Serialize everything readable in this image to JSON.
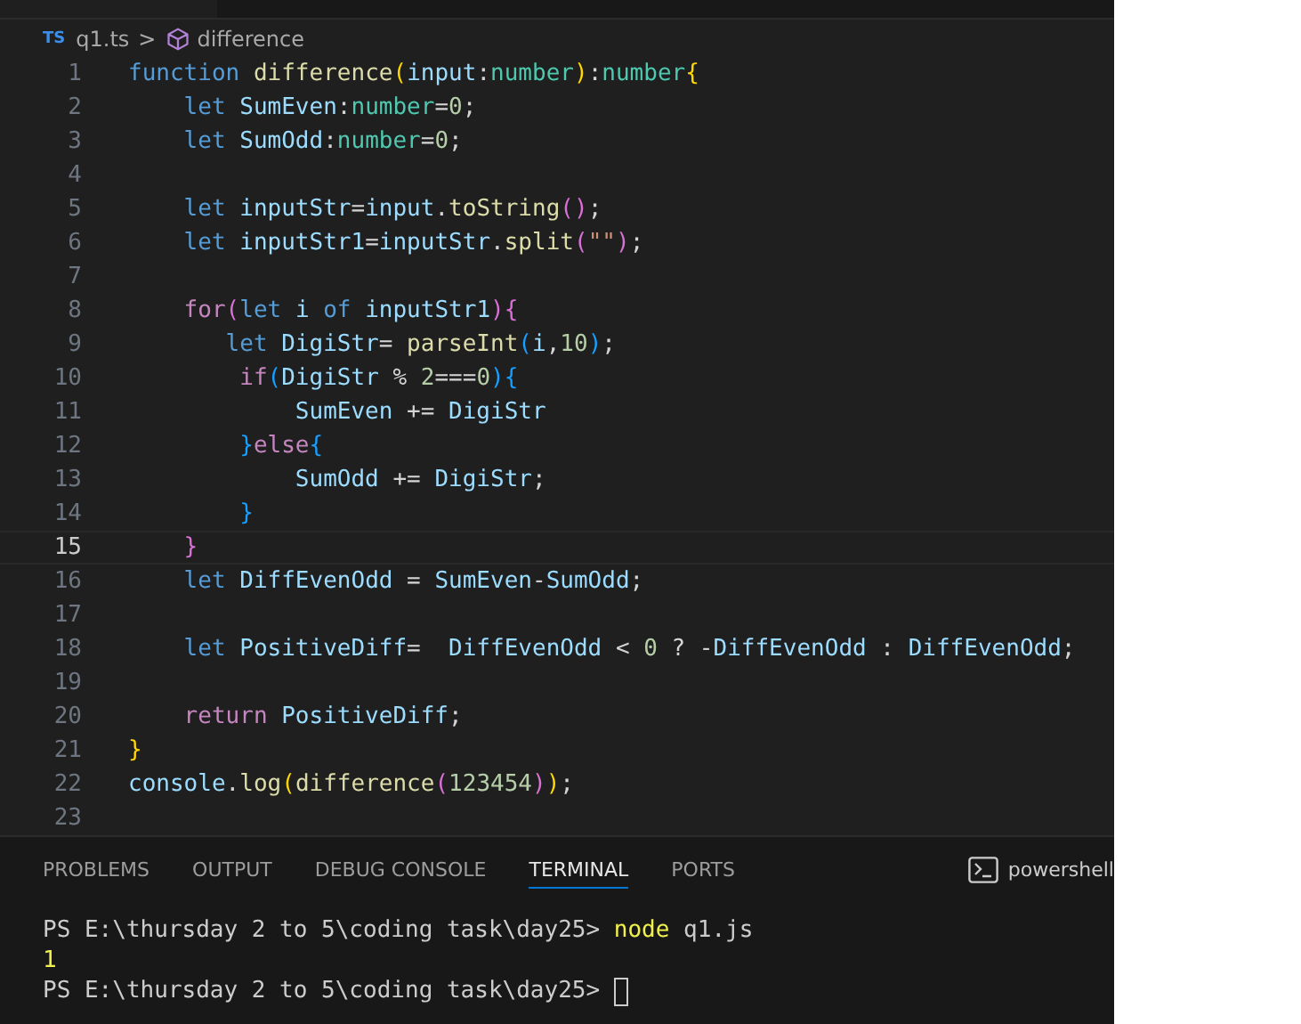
{
  "breadcrumb": {
    "file_badge": "TS",
    "file": "q1.ts",
    "separator": ">",
    "symbol": "difference"
  },
  "code_lines": [
    {
      "number": "1",
      "current": false,
      "tokens": [
        {
          "t": "function ",
          "color": "#569cd6"
        },
        {
          "t": "difference",
          "color": "#dcdcaa"
        },
        {
          "t": "(",
          "color": "#ffd700"
        },
        {
          "t": "input",
          "color": "#9cdcfe"
        },
        {
          "t": ":",
          "color": "#d4d4d4"
        },
        {
          "t": "number",
          "color": "#4ec9b0"
        },
        {
          "t": ")",
          "color": "#ffd700"
        },
        {
          "t": ":",
          "color": "#d4d4d4"
        },
        {
          "t": "number",
          "color": "#4ec9b0"
        },
        {
          "t": "{",
          "color": "#ffd700"
        }
      ]
    },
    {
      "number": "2",
      "current": false,
      "tokens": [
        {
          "t": "    let ",
          "color": "#569cd6"
        },
        {
          "t": "SumEven",
          "color": "#9cdcfe"
        },
        {
          "t": ":",
          "color": "#d4d4d4"
        },
        {
          "t": "number",
          "color": "#4ec9b0"
        },
        {
          "t": "=",
          "color": "#d4d4d4"
        },
        {
          "t": "0",
          "color": "#b5cea8"
        },
        {
          "t": ";",
          "color": "#d4d4d4"
        }
      ]
    },
    {
      "number": "3",
      "current": false,
      "tokens": [
        {
          "t": "    let ",
          "color": "#569cd6"
        },
        {
          "t": "SumOdd",
          "color": "#9cdcfe"
        },
        {
          "t": ":",
          "color": "#d4d4d4"
        },
        {
          "t": "number",
          "color": "#4ec9b0"
        },
        {
          "t": "=",
          "color": "#d4d4d4"
        },
        {
          "t": "0",
          "color": "#b5cea8"
        },
        {
          "t": ";",
          "color": "#d4d4d4"
        }
      ]
    },
    {
      "number": "4",
      "current": false
    },
    {
      "number": "5",
      "current": false,
      "tokens": [
        {
          "t": "    let ",
          "color": "#569cd6"
        },
        {
          "t": "inputStr",
          "color": "#9cdcfe"
        },
        {
          "t": "=",
          "color": "#d4d4d4"
        },
        {
          "t": "input",
          "color": "#9cdcfe"
        },
        {
          "t": ".",
          "color": "#d4d4d4"
        },
        {
          "t": "toString",
          "color": "#dcdcaa"
        },
        {
          "t": "()",
          "color": "#da70d6"
        },
        {
          "t": ";",
          "color": "#d4d4d4"
        }
      ]
    },
    {
      "number": "6",
      "current": false,
      "tokens": [
        {
          "t": "    let ",
          "color": "#569cd6"
        },
        {
          "t": "inputStr1",
          "color": "#9cdcfe"
        },
        {
          "t": "=",
          "color": "#d4d4d4"
        },
        {
          "t": "inputStr",
          "color": "#9cdcfe"
        },
        {
          "t": ".",
          "color": "#d4d4d4"
        },
        {
          "t": "split",
          "color": "#dcdcaa"
        },
        {
          "t": "(",
          "color": "#da70d6"
        },
        {
          "t": "\"\"",
          "color": "#ce9178"
        },
        {
          "t": ")",
          "color": "#da70d6"
        },
        {
          "t": ";",
          "color": "#d4d4d4"
        }
      ]
    },
    {
      "number": "7",
      "current": false
    },
    {
      "number": "8",
      "current": false,
      "tokens": [
        {
          "t": "    for",
          "color": "#c586c0"
        },
        {
          "t": "(",
          "color": "#da70d6"
        },
        {
          "t": "let ",
          "color": "#569cd6"
        },
        {
          "t": "i ",
          "color": "#9cdcfe"
        },
        {
          "t": "of ",
          "color": "#569cd6"
        },
        {
          "t": "inputStr1",
          "color": "#9cdcfe"
        },
        {
          "t": "){",
          "color": "#da70d6"
        }
      ]
    },
    {
      "number": "9",
      "current": false,
      "tokens": [
        {
          "t": "       let ",
          "color": "#569cd6"
        },
        {
          "t": "DigiStr",
          "color": "#9cdcfe"
        },
        {
          "t": "= ",
          "color": "#d4d4d4"
        },
        {
          "t": "parseInt",
          "color": "#dcdcaa"
        },
        {
          "t": "(",
          "color": "#179fff"
        },
        {
          "t": "i",
          "color": "#9cdcfe"
        },
        {
          "t": ",",
          "color": "#d4d4d4"
        },
        {
          "t": "10",
          "color": "#b5cea8"
        },
        {
          "t": ")",
          "color": "#179fff"
        },
        {
          "t": ";",
          "color": "#d4d4d4"
        }
      ]
    },
    {
      "number": "10",
      "current": false,
      "tokens": [
        {
          "t": "        if",
          "color": "#c586c0"
        },
        {
          "t": "(",
          "color": "#179fff"
        },
        {
          "t": "DigiStr ",
          "color": "#9cdcfe"
        },
        {
          "t": "% ",
          "color": "#d4d4d4"
        },
        {
          "t": "2",
          "color": "#b5cea8"
        },
        {
          "t": "===",
          "color": "#d4d4d4"
        },
        {
          "t": "0",
          "color": "#b5cea8"
        },
        {
          "t": "){",
          "color": "#179fff"
        }
      ]
    },
    {
      "number": "11",
      "current": false,
      "tokens": [
        {
          "t": "            SumEven ",
          "color": "#9cdcfe"
        },
        {
          "t": "+= ",
          "color": "#d4d4d4"
        },
        {
          "t": "DigiStr",
          "color": "#9cdcfe"
        }
      ]
    },
    {
      "number": "12",
      "current": false,
      "tokens": [
        {
          "t": "        }",
          "color": "#179fff"
        },
        {
          "t": "else",
          "color": "#c586c0"
        },
        {
          "t": "{",
          "color": "#179fff"
        }
      ]
    },
    {
      "number": "13",
      "current": false,
      "tokens": [
        {
          "t": "            SumOdd ",
          "color": "#9cdcfe"
        },
        {
          "t": "+= ",
          "color": "#d4d4d4"
        },
        {
          "t": "DigiStr",
          "color": "#9cdcfe"
        },
        {
          "t": ";",
          "color": "#d4d4d4"
        }
      ]
    },
    {
      "number": "14",
      "current": false,
      "tokens": [
        {
          "t": "        }",
          "color": "#179fff"
        }
      ]
    },
    {
      "number": "15",
      "current": true,
      "tokens": [
        {
          "t": "    }",
          "color": "#da70d6"
        }
      ]
    },
    {
      "number": "16",
      "current": false,
      "tokens": [
        {
          "t": "    let ",
          "color": "#569cd6"
        },
        {
          "t": "DiffEvenOdd ",
          "color": "#9cdcfe"
        },
        {
          "t": "= ",
          "color": "#d4d4d4"
        },
        {
          "t": "SumEven",
          "color": "#9cdcfe"
        },
        {
          "t": "-",
          "color": "#d4d4d4"
        },
        {
          "t": "SumOdd",
          "color": "#9cdcfe"
        },
        {
          "t": ";",
          "color": "#d4d4d4"
        }
      ]
    },
    {
      "number": "17",
      "current": false
    },
    {
      "number": "18",
      "current": false,
      "tokens": [
        {
          "t": "    let ",
          "color": "#569cd6"
        },
        {
          "t": "PositiveDiff",
          "color": "#9cdcfe"
        },
        {
          "t": "=  ",
          "color": "#d4d4d4"
        },
        {
          "t": "DiffEvenOdd ",
          "color": "#9cdcfe"
        },
        {
          "t": "< ",
          "color": "#d4d4d4"
        },
        {
          "t": "0",
          "color": "#b5cea8"
        },
        {
          "t": " ? -",
          "color": "#d4d4d4"
        },
        {
          "t": "DiffEvenOdd ",
          "color": "#9cdcfe"
        },
        {
          "t": ": ",
          "color": "#d4d4d4"
        },
        {
          "t": "DiffEvenOdd",
          "color": "#9cdcfe"
        },
        {
          "t": ";",
          "color": "#d4d4d4"
        }
      ]
    },
    {
      "number": "19",
      "current": false
    },
    {
      "number": "20",
      "current": false,
      "tokens": [
        {
          "t": "    return ",
          "color": "#c586c0"
        },
        {
          "t": "PositiveDiff",
          "color": "#9cdcfe"
        },
        {
          "t": ";",
          "color": "#d4d4d4"
        }
      ]
    },
    {
      "number": "21",
      "current": false,
      "tokens": [
        {
          "t": "}",
          "color": "#ffd700"
        }
      ]
    },
    {
      "number": "22",
      "current": false,
      "tokens": [
        {
          "t": "console",
          "color": "#9cdcfe"
        },
        {
          "t": ".",
          "color": "#d4d4d4"
        },
        {
          "t": "log",
          "color": "#dcdcaa"
        },
        {
          "t": "(",
          "color": "#ffd700"
        },
        {
          "t": "difference",
          "color": "#dcdcaa"
        },
        {
          "t": "(",
          "color": "#da70d6"
        },
        {
          "t": "123454",
          "color": "#b5cea8"
        },
        {
          "t": ")",
          "color": "#da70d6"
        },
        {
          "t": ")",
          "color": "#ffd700"
        },
        {
          "t": ";",
          "color": "#d4d4d4"
        }
      ]
    },
    {
      "number": "23",
      "current": false
    }
  ],
  "panel_tabs": [
    {
      "label": "PROBLEMS",
      "selected": false
    },
    {
      "label": "OUTPUT",
      "selected": false
    },
    {
      "label": "DEBUG CONSOLE",
      "selected": false
    },
    {
      "label": "TERMINAL",
      "selected": true
    },
    {
      "label": "PORTS",
      "selected": false
    }
  ],
  "terminal_shell": "powershell",
  "terminal_lines": [
    {
      "kind": "command",
      "prompt": "PS E:\\thursday 2 to 5\\coding task\\day25> ",
      "command": "node",
      "args": " q1.js"
    },
    {
      "kind": "output",
      "text": "1"
    },
    {
      "kind": "input",
      "prompt": "PS E:\\thursday 2 to 5\\coding task\\day25> "
    }
  ]
}
